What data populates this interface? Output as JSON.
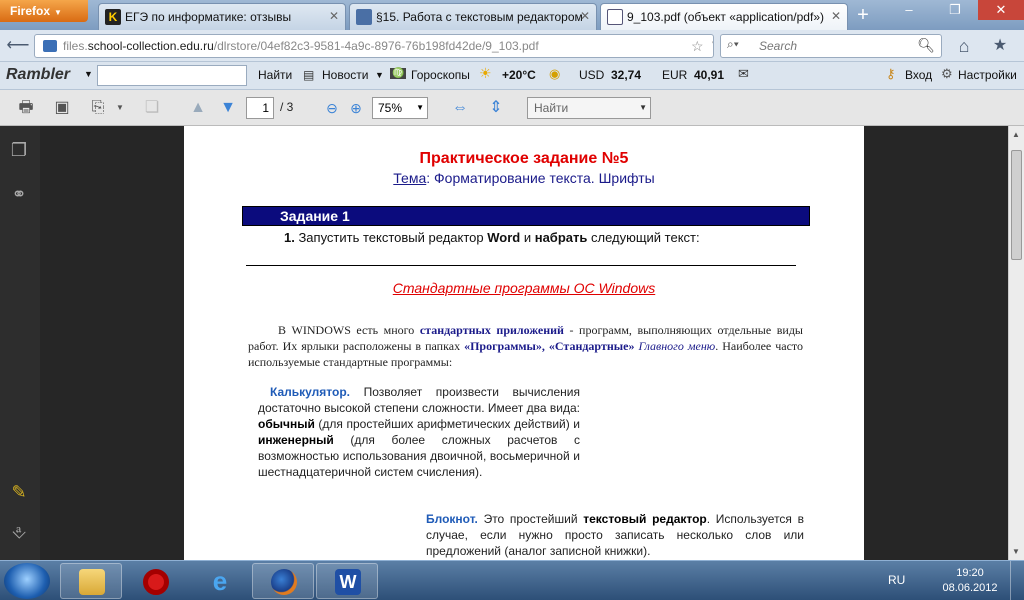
{
  "browser": {
    "app_button": "Firefox",
    "tabs": [
      {
        "label": "ЕГЭ по информатике: отзывы",
        "favicon_color": "#222222"
      },
      {
        "label": "§15. Работа с текстовым редактором",
        "favicon_color": "#4a6fa5"
      },
      {
        "label": "9_103.pdf (объект «application/pdf»)",
        "favicon_color": "#5577aa"
      }
    ],
    "url_prefix": "files.",
    "url_host": "school-collection.edu.ru",
    "url_path": "/dlrstore/04ef82c3-9581-4a9c-8976-76b198fd42de/9_103.pdf",
    "search_placeholder": "Search"
  },
  "rambler": {
    "logo": "Rambler",
    "links": [
      "Найти",
      "Новости",
      "Гороскопы"
    ],
    "temperature": "+20°C",
    "usd_label": "USD",
    "usd_value": "32,74",
    "eur_label": "EUR",
    "eur_value": "40,91",
    "login": "Вход",
    "settings": "Настройки"
  },
  "pdf_toolbar": {
    "page": "1",
    "page_total": "/ 3",
    "zoom": "75%",
    "find_placeholder": "Найти"
  },
  "document": {
    "title": "Практическое задание №5",
    "subtitle_label": "Тема",
    "subtitle_text": ": Форматирование текста. Шрифты",
    "task_header": "Задание 1",
    "task_num": "1.",
    "task_text_1": " Запустить текстовый редактор ",
    "task_word": "Word",
    "task_text_2": " и ",
    "task_type": "набрать",
    "task_text_3": " следующий текст:",
    "std_heading": "Стандартные программы ОС Windows",
    "win_p1": "В WINDOWS есть много ",
    "win_std": "стандартных приложений",
    "win_p2": " - программ, выполняющих отдельные виды работ. Их ярлыки расположены в папках ",
    "win_progs": "«Программы», «Стандартные»",
    "win_p3": " ",
    "win_menu": "Главного меню",
    "win_p4": ". Наиболее часто используемые стандартные программы:",
    "calc_title": "Калькулятор.",
    "calc_p1": " Позволяет произвести вычисления достаточно высокой степени сложности. Имеет два вида: ",
    "calc_b1": "обычный",
    "calc_p2": " (для простейших арифметических действий) и ",
    "calc_b2": "инженерный",
    "calc_p3": " (для более сложных расчетов с возможностью использования двоичной, восьмеричной и шестнадцатеричной систем счисления).",
    "notepad_title": "Блокнот.",
    "notepad_p1": " Это простейший ",
    "notepad_b1": "текстовый редактор",
    "notepad_p2": ". Используется в случае, если нужно просто записать несколько слов или предложений (аналог записной книжки)."
  },
  "taskbar": {
    "lang": "RU",
    "time": "19:20",
    "date": "08.06.2012",
    "apps": [
      "explorer-icon",
      "opera-icon",
      "ie-icon",
      "firefox-icon",
      "word-icon"
    ]
  },
  "colors": {
    "title_red": "#e00000",
    "task_bar_blue": "#0b0b7d",
    "link_blue": "#1f5bb7",
    "firefox_orange": "#e07b20"
  }
}
